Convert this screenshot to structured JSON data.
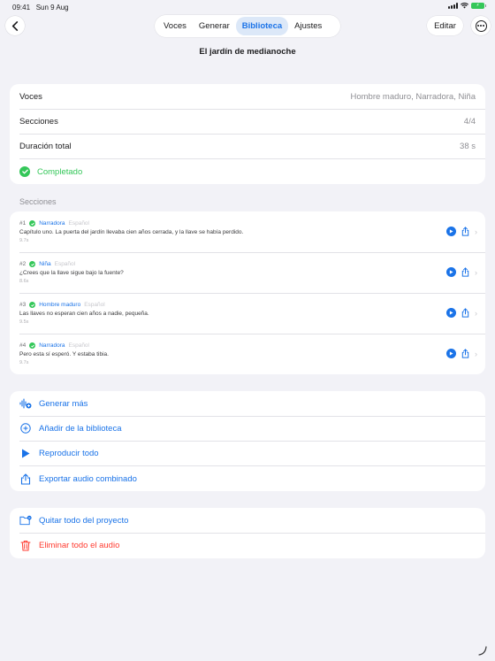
{
  "status": {
    "time": "09:41",
    "date": "Sun 9 Aug"
  },
  "tabs": [
    {
      "label": "Voces",
      "active": false
    },
    {
      "label": "Generar",
      "active": false
    },
    {
      "label": "Biblioteca",
      "active": true
    },
    {
      "label": "Ajustes",
      "active": false
    }
  ],
  "edit_label": "Editar",
  "project_title": "El jardín de medianoche",
  "summary": {
    "voices_label": "Voces",
    "voices_value": "Hombre maduro, Narradora, Niña",
    "sections_label": "Secciones",
    "sections_value": "4/4",
    "duration_label": "Duración total",
    "duration_value": "38 s",
    "status_label": "Completado"
  },
  "sections_header": "Secciones",
  "sections": [
    {
      "num": "#1",
      "voice": "Narradora",
      "lang": "Español",
      "text": "Capítulo uno. La puerta del jardín llevaba cien años cerrada, y la llave se había perdido.",
      "duration": "9.7s"
    },
    {
      "num": "#2",
      "voice": "Niña",
      "lang": "Español",
      "text": "¿Crees que la llave sigue bajo la fuente?",
      "duration": "8.6s"
    },
    {
      "num": "#3",
      "voice": "Hombre maduro",
      "lang": "Español",
      "text": "Las llaves no esperan cien años a nadie, pequeña.",
      "duration": "9.5s"
    },
    {
      "num": "#4",
      "voice": "Narradora",
      "lang": "Español",
      "text": "Pero esta sí esperó. Y estaba tibia.",
      "duration": "9.7s"
    }
  ],
  "actions": [
    {
      "label": "Generar más",
      "icon": "waveform-plus-icon"
    },
    {
      "label": "Añadir de la biblioteca",
      "icon": "plus-circle-icon"
    },
    {
      "label": "Reproducir todo",
      "icon": "play-icon"
    },
    {
      "label": "Exportar audio combinado",
      "icon": "share-icon"
    }
  ],
  "danger": [
    {
      "label": "Quitar todo del proyecto",
      "icon": "folder-remove-icon",
      "color": "#1a73e8"
    },
    {
      "label": "Eliminar todo el audio",
      "icon": "trash-icon",
      "color": "#ff3b30"
    }
  ],
  "colors": {
    "accent": "#1a73e8",
    "success": "#34c759",
    "destructive": "#ff3b30",
    "background": "#f2f2f7"
  }
}
